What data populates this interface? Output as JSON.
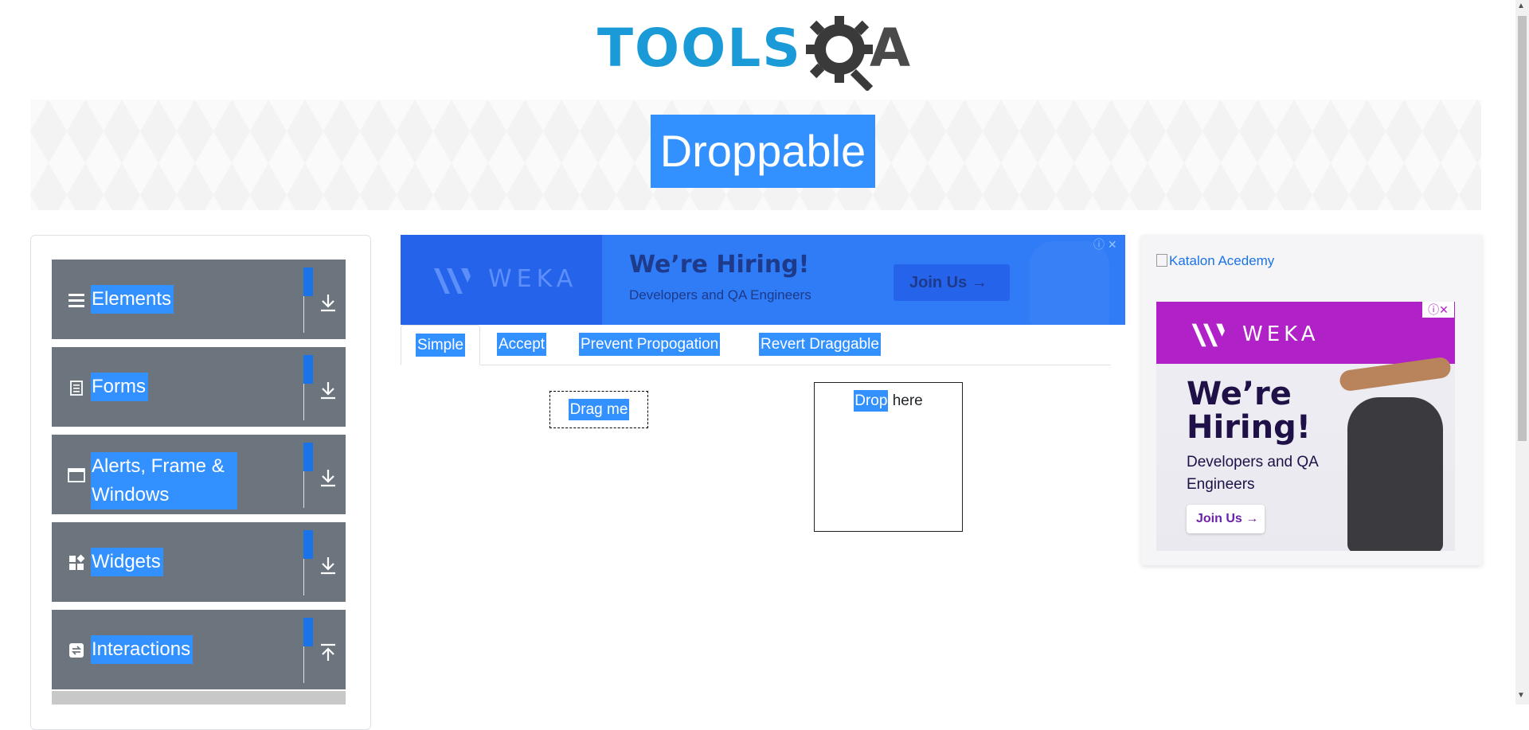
{
  "header": {
    "logo_text": "TOOLS",
    "logo_suffix": "A"
  },
  "page": {
    "title": "Droppable"
  },
  "sidebar": {
    "groups": [
      {
        "label": "Elements",
        "icon": "hamburger-icon",
        "expanded": false
      },
      {
        "label": "Forms",
        "icon": "document-icon",
        "expanded": false
      },
      {
        "label": "Alerts, Frame & Windows",
        "icon": "window-icon",
        "expanded": false
      },
      {
        "label": "Widgets",
        "icon": "widgets-icon",
        "expanded": false
      },
      {
        "label": "Interactions",
        "icon": "interactions-icon",
        "expanded": true
      }
    ]
  },
  "top_ad": {
    "brand": "WEKA",
    "headline": "We’re Hiring!",
    "subline": "Developers and QA Engineers",
    "button": "Join Us",
    "info": "ⓘ ✕"
  },
  "tabs": [
    "Simple",
    "Accept",
    "Prevent Propogation",
    "Revert Draggable"
  ],
  "active_tab": "Simple",
  "draggable": {
    "label": "Drag me"
  },
  "droppable": {
    "label_selected": "Drop",
    "label_rest": " here"
  },
  "right_ad": {
    "link_text": "Katalon Acedemy",
    "brand": "WEKA",
    "headline": "We’re Hiring!",
    "subline": "Developers and QA Engineers",
    "button": "Join Us →",
    "info": "ⓘ✕"
  },
  "colors": {
    "selection": "#3390ff",
    "nav_group_bg": "#6c757d",
    "logo_blue": "#1a9bd7",
    "accent_blue": "#1a73e8"
  }
}
